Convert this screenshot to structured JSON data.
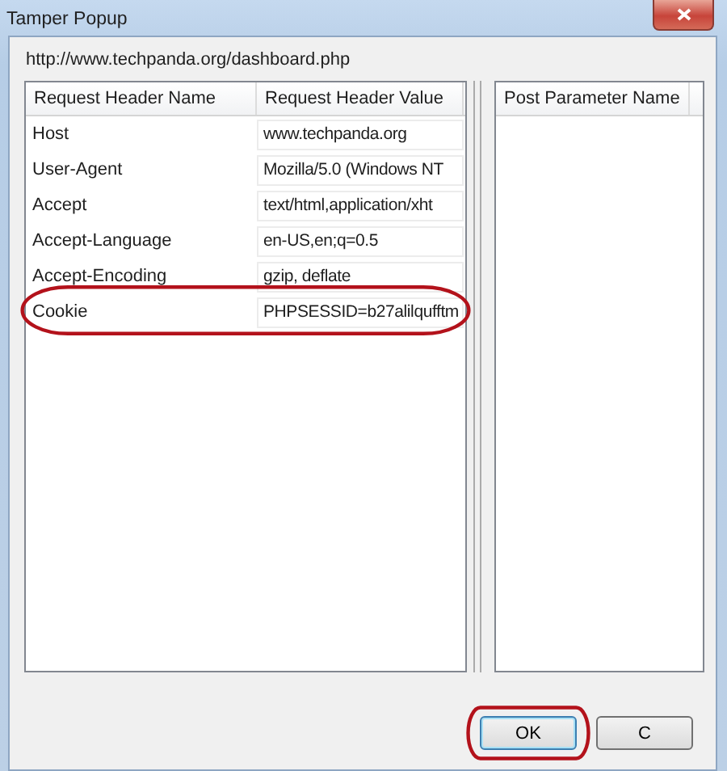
{
  "window": {
    "title": "Tamper Popup"
  },
  "url": "http://www.techpanda.org/dashboard.php",
  "header_table": {
    "columns": [
      "Request Header Name",
      "Request Header Value"
    ],
    "rows": [
      {
        "name": "Host",
        "value": "www.techpanda.org",
        "highlighted": false
      },
      {
        "name": "User-Agent",
        "value": "Mozilla/5.0 (Windows NT",
        "highlighted": false
      },
      {
        "name": "Accept",
        "value": "text/html,application/xht",
        "highlighted": false
      },
      {
        "name": "Accept-Language",
        "value": "en-US,en;q=0.5",
        "highlighted": false
      },
      {
        "name": "Accept-Encoding",
        "value": "gzip, deflate",
        "highlighted": false
      },
      {
        "name": "Cookie",
        "value": "PHPSESSID=b27alilqufftm",
        "highlighted": true
      }
    ]
  },
  "post_table": {
    "columns": [
      "Post Parameter Name"
    ]
  },
  "buttons": [
    {
      "label": "OK",
      "highlighted": true
    },
    {
      "label": "C",
      "highlighted": false
    }
  ]
}
